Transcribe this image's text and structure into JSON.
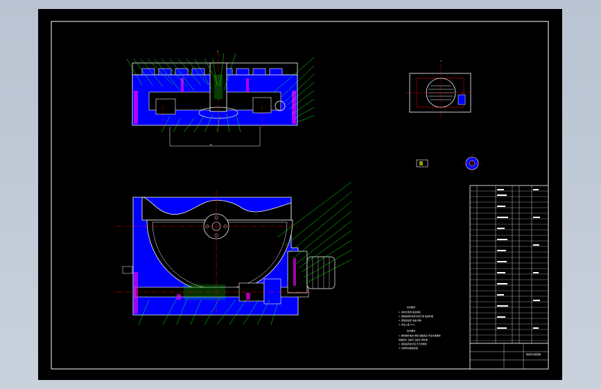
{
  "drawing": {
    "notes_heading": "技术要求",
    "notes_lines": [
      "1. 零件去毛刺 锐边倒钝",
      "2. 装配前所有零件清洗干净 油漆处理",
      "3. 装配后检查 涂油 防锈",
      "4. 未注公差 IT14"
    ],
    "notes_heading_2": "技术要求",
    "notes_lines_2": [
      "1. 蜗轮蜗杆啮合 侧隙 接触斑点 符合标准要求",
      "   接触斑点 沿齿高 沿齿长 按标准",
      "2. 装配后转动灵活 无卡滞现象",
      "3. 机床转台精度检验"
    ],
    "section_label": "A",
    "view_label": "B",
    "title_block_name": "数控转台装配图"
  },
  "colors": {
    "sheet_bg": "#000000",
    "outline": "#ffffff",
    "part_fill": "#0000ff",
    "leader": "#00ff00",
    "centerline": "#ff0000",
    "cut_face": "#ff00ff",
    "hidden": "#00ffff",
    "accent": "#ffff00"
  }
}
